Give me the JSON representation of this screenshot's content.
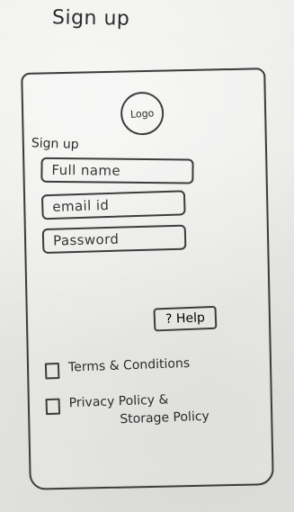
{
  "page": {
    "title": "Sign up"
  },
  "signup_card": {
    "logo_text": "Logo",
    "form_title": "Sign up",
    "fields": {
      "full_name_placeholder": "Full name",
      "email_placeholder": "email id",
      "password_placeholder": "Password"
    },
    "help_label": "? Help",
    "checkboxes": {
      "terms_label": "Terms & Conditions",
      "privacy_label_line1": "Privacy Policy &",
      "privacy_label_line2": "Storage Policy"
    }
  }
}
